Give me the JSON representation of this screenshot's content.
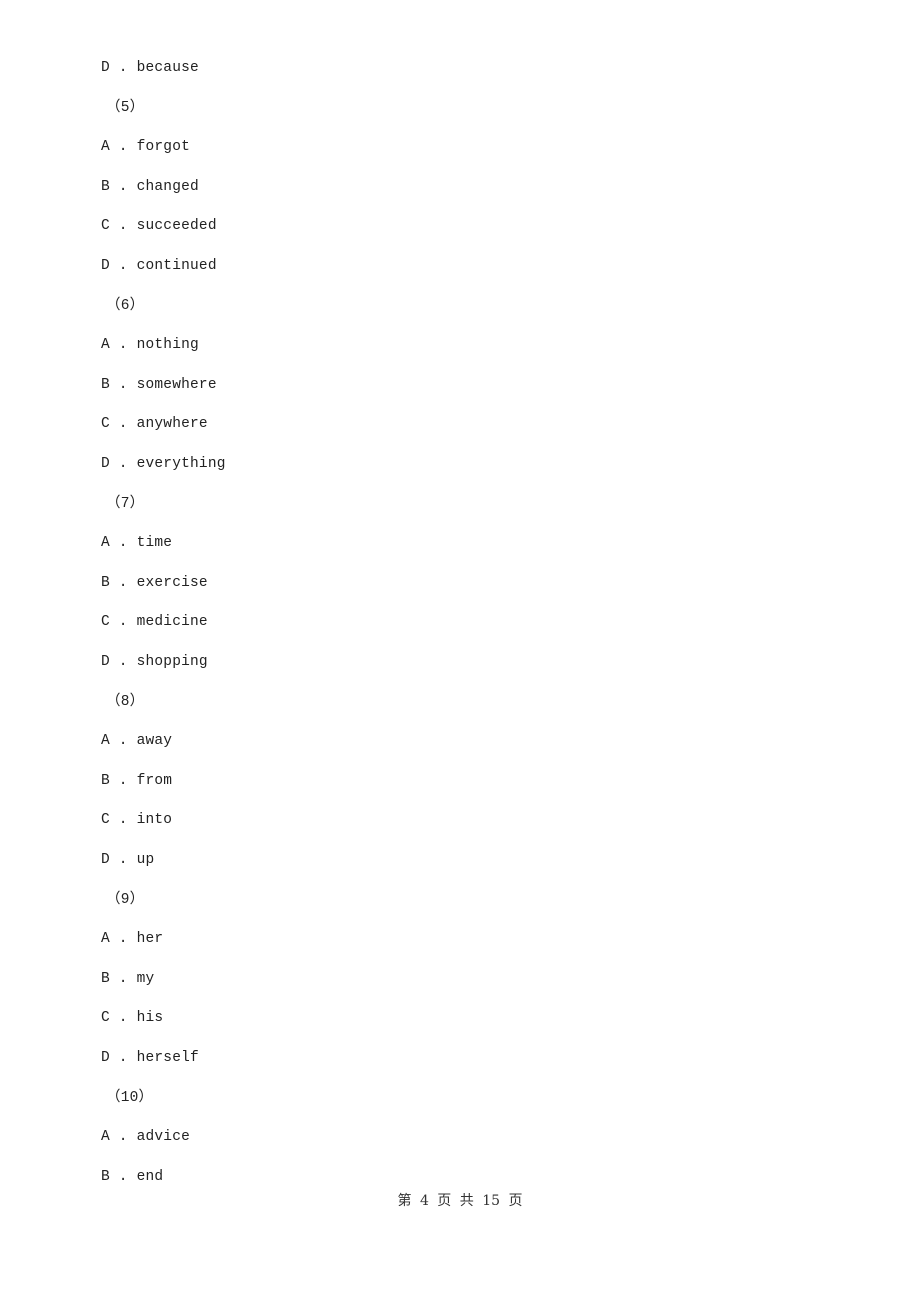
{
  "items": [
    {
      "type": "option",
      "text": "D . because"
    },
    {
      "type": "question",
      "text": "（5）"
    },
    {
      "type": "option",
      "text": "A . forgot"
    },
    {
      "type": "option",
      "text": "B . changed"
    },
    {
      "type": "option",
      "text": "C . succeeded"
    },
    {
      "type": "option",
      "text": "D . continued"
    },
    {
      "type": "question",
      "text": "（6）"
    },
    {
      "type": "option",
      "text": "A . nothing"
    },
    {
      "type": "option",
      "text": "B . somewhere"
    },
    {
      "type": "option",
      "text": "C . anywhere"
    },
    {
      "type": "option",
      "text": "D . everything"
    },
    {
      "type": "question",
      "text": "（7）"
    },
    {
      "type": "option",
      "text": "A . time"
    },
    {
      "type": "option",
      "text": "B . exercise"
    },
    {
      "type": "option",
      "text": "C . medicine"
    },
    {
      "type": "option",
      "text": "D . shopping"
    },
    {
      "type": "question",
      "text": "（8）"
    },
    {
      "type": "option",
      "text": "A . away"
    },
    {
      "type": "option",
      "text": "B . from"
    },
    {
      "type": "option",
      "text": "C . into"
    },
    {
      "type": "option",
      "text": "D . up"
    },
    {
      "type": "question",
      "text": "（9）"
    },
    {
      "type": "option",
      "text": "A . her"
    },
    {
      "type": "option",
      "text": "B . my"
    },
    {
      "type": "option",
      "text": "C . his"
    },
    {
      "type": "option",
      "text": "D . herself"
    },
    {
      "type": "question",
      "text": "（10）"
    },
    {
      "type": "option",
      "text": "A . advice"
    },
    {
      "type": "option",
      "text": "B . end"
    }
  ],
  "footer": "第 4 页 共 15 页"
}
